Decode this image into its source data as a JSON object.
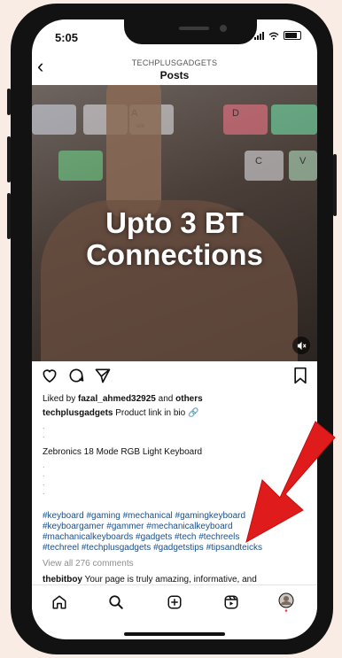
{
  "status_bar": {
    "time": "5:05"
  },
  "header": {
    "account": "TECHPLUSGADGETS",
    "title": "Posts"
  },
  "media": {
    "overlay_text_line1": "Upto 3 BT",
    "overlay_text_line2": "Connections",
    "keys": [
      "A",
      "win",
      "D",
      "C",
      "V"
    ]
  },
  "post": {
    "liked_by_prefix": "Liked by ",
    "liked_by_user": "fazal_ahmed32925",
    "liked_by_and": " and ",
    "liked_by_others": "others",
    "caption_user": "techplusgadgets",
    "caption_text": " Product link in bio 🔗",
    "description": "Zebronics 18 Mode RGB Light Keyboard",
    "hashtags_line1": "#keyboard #gaming #mechanical #gamingkeyboard",
    "hashtags_line2": "#keyboargamer #gammer #mechanicalkeyboard",
    "hashtags_line3": "#machanicalkeyboards #gadgets #tech #techreels",
    "hashtags_line4": "#techreel #techplusgadgets #gadgetstips #tipsandteicks",
    "view_comments": "View all 276 comments",
    "comment_user": "thebitboy",
    "comment_text": " Your page is truly amazing, informative, and"
  },
  "colors": {
    "annotation_arrow": "#e01b1b",
    "hashtag": "#1a4f8b",
    "background": "#f9ece4"
  },
  "icons": [
    "back-arrow-icon",
    "heart-icon",
    "comment-icon",
    "share-icon",
    "bookmark-icon",
    "home-icon",
    "search-icon",
    "create-icon",
    "reels-icon",
    "profile-avatar",
    "mute-icon"
  ]
}
